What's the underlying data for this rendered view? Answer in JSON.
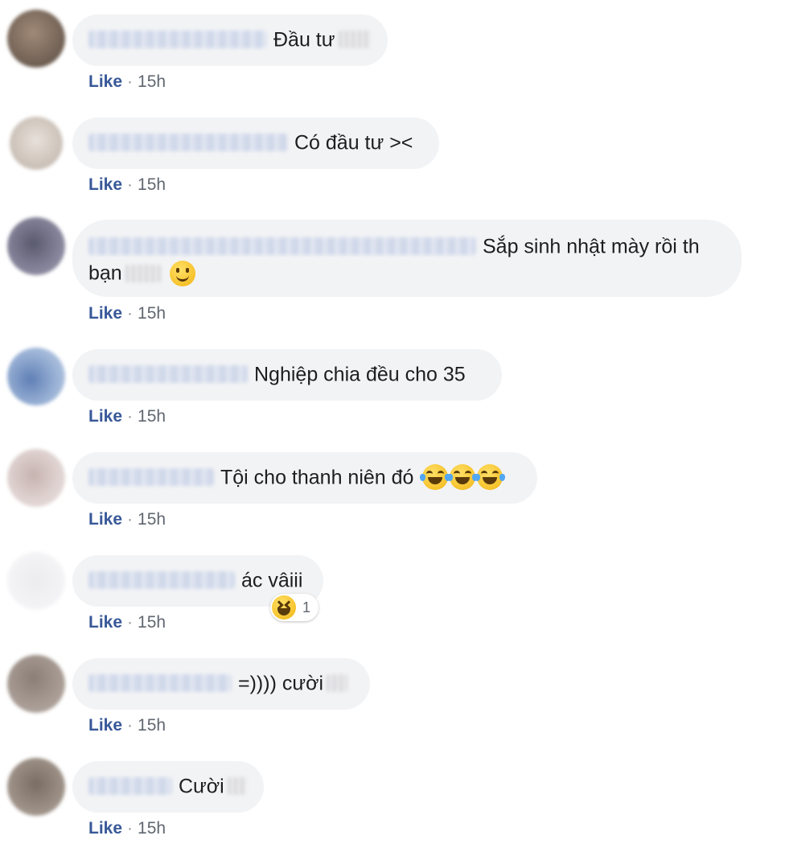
{
  "like_label": "Like",
  "separator": "·",
  "comments": [
    {
      "text": "Đầu tư",
      "time": "15h"
    },
    {
      "text": "Có đầu tư ><",
      "time": "15h"
    },
    {
      "text_line1": "Sắp sinh nhật mày rồi th",
      "text_line2": "bạn",
      "time": "15h"
    },
    {
      "text": "Nghiệp chia đều cho 35",
      "time": "15h"
    },
    {
      "text": "Tội cho thanh niên đó",
      "time": "15h"
    },
    {
      "text": "ác vâiii",
      "time": "15h",
      "reaction_count": "1"
    },
    {
      "text": "=)))) cười",
      "time": "15h"
    },
    {
      "text": "Cười",
      "time": "15h"
    }
  ],
  "colors": {
    "like_link": "#385898",
    "bubble_bg": "#f2f3f5",
    "meta_text": "#606770"
  },
  "icons": {
    "smile": "slightly-smiling-face-icon",
    "joy": "face-with-tears-of-joy-icon",
    "haha": "haha-reaction-icon"
  }
}
